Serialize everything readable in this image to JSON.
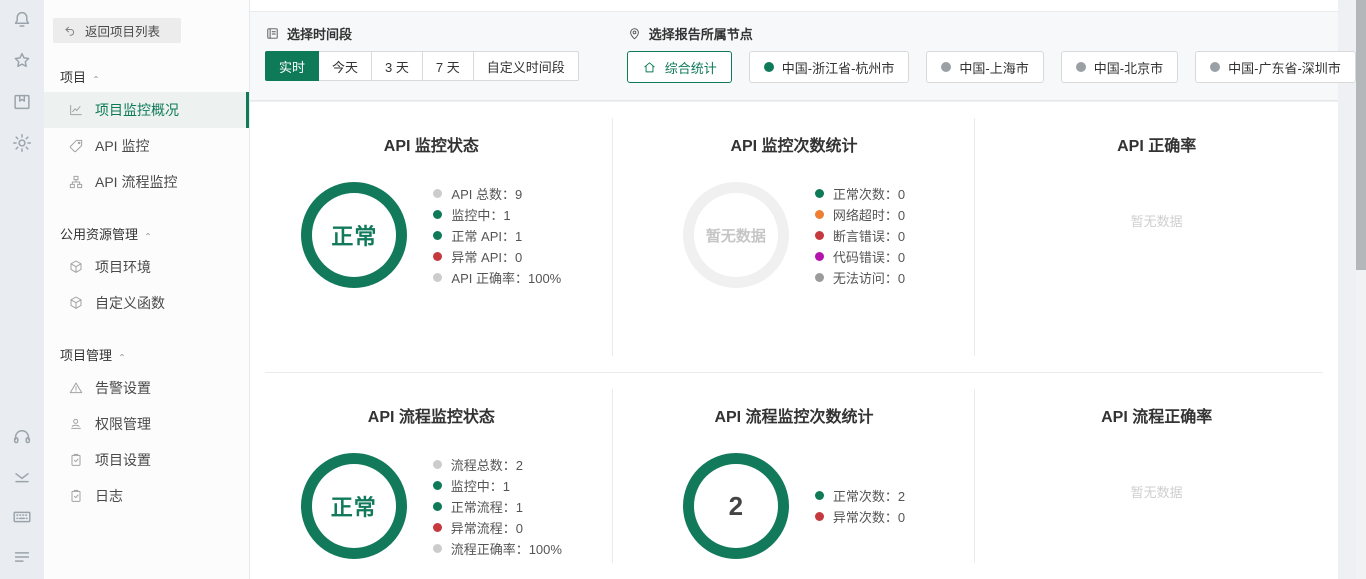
{
  "accent": "#0e7a58",
  "punctuation": {
    "colon": "："
  },
  "rail": {
    "top_icons": [
      "bell",
      "star",
      "archive",
      "gear"
    ],
    "bottom_icons": [
      "headset",
      "inbox",
      "keyboard",
      "list"
    ]
  },
  "sidebar": {
    "back_button": "返回项目列表",
    "sections": [
      {
        "label": "项目",
        "items": [
          {
            "icon": "chart-line",
            "label": "项目监控概况",
            "active": true
          },
          {
            "icon": "tag",
            "label": "API 监控",
            "active": false
          },
          {
            "icon": "sitemap",
            "label": "API 流程监控",
            "active": false
          }
        ]
      },
      {
        "label": "公用资源管理",
        "items": [
          {
            "icon": "cube",
            "label": "项目环境",
            "active": false
          },
          {
            "icon": "cube",
            "label": "自定义函数",
            "active": false
          }
        ]
      },
      {
        "label": "项目管理",
        "items": [
          {
            "icon": "warning",
            "label": "告警设置",
            "active": false
          },
          {
            "icon": "user",
            "label": "权限管理",
            "active": false
          },
          {
            "icon": "clipboard",
            "label": "项目设置",
            "active": false
          },
          {
            "icon": "clipboard",
            "label": "日志",
            "active": false
          }
        ]
      }
    ]
  },
  "filterbar": {
    "time": {
      "label": "选择时间段",
      "options": [
        {
          "label": "实时",
          "active": true
        },
        {
          "label": "今天",
          "active": false
        },
        {
          "label": "3 天",
          "active": false
        },
        {
          "label": "7 天",
          "active": false
        },
        {
          "label": "自定义时间段",
          "active": false
        }
      ]
    },
    "node": {
      "label": "选择报告所属节点",
      "summary_label": "综合统计",
      "nodes": [
        {
          "label": "中国-浙江省-杭州市",
          "dot_color": "#0e7a58"
        },
        {
          "label": "中国-上海市",
          "dot_color": "#9aa0a6"
        },
        {
          "label": "中国-北京市",
          "dot_color": "#9aa0a6"
        },
        {
          "label": "中国-广东省-深圳市",
          "dot_color": "#9aa0a6"
        }
      ]
    }
  },
  "cards": [
    {
      "title": "API 监控状态",
      "ring": {
        "text": "正常",
        "variant": "ok",
        "color": "#127a5b",
        "text_color": "#127a5b"
      },
      "legend": [
        {
          "dot": "#cccccc",
          "label": "API 总数",
          "value": "9"
        },
        {
          "dot": "#0e7a58",
          "label": "监控中",
          "value": "1"
        },
        {
          "dot": "#0e7a58",
          "label": "正常 API",
          "value": "1"
        },
        {
          "dot": "#c5393e",
          "label": "异常 API",
          "value": "0"
        },
        {
          "dot": "#cccccc",
          "label": "API 正确率",
          "value": "100%"
        }
      ]
    },
    {
      "title": "API 监控次数统计",
      "ring": {
        "text": "暂无数据",
        "variant": "empty",
        "color": "#f0f0f0",
        "text_color": "#c6c6c6"
      },
      "legend": [
        {
          "dot": "#0e7a58",
          "label": "正常次数",
          "value": "0"
        },
        {
          "dot": "#ee7e31",
          "label": "网络超时",
          "value": "0"
        },
        {
          "dot": "#c5393e",
          "label": "断言错误",
          "value": "0"
        },
        {
          "dot": "#b513ad",
          "label": "代码错误",
          "value": "0"
        },
        {
          "dot": "#9b9b9b",
          "label": "无法访问",
          "value": "0"
        }
      ]
    },
    {
      "title": "API 正确率",
      "empty_text": "暂无数据"
    },
    {
      "title": "API 流程监控状态",
      "ring": {
        "text": "正常",
        "variant": "ok",
        "color": "#127a5b",
        "text_color": "#127a5b"
      },
      "legend": [
        {
          "dot": "#cccccc",
          "label": "流程总数",
          "value": "2"
        },
        {
          "dot": "#0e7a58",
          "label": "监控中",
          "value": "1"
        },
        {
          "dot": "#0e7a58",
          "label": "正常流程",
          "value": "1"
        },
        {
          "dot": "#c5393e",
          "label": "异常流程",
          "value": "0"
        },
        {
          "dot": "#cccccc",
          "label": "流程正确率",
          "value": "100%"
        }
      ]
    },
    {
      "title": "API 流程监控次数统计",
      "ring": {
        "text": "2",
        "variant": "count",
        "color": "#127a5b",
        "text_color": "#444444"
      },
      "legend": [
        {
          "dot": "#0e7a58",
          "label": "正常次数",
          "value": "2"
        },
        {
          "dot": "#c5393e",
          "label": "异常次数",
          "value": "0"
        }
      ]
    },
    {
      "title": "API 流程正确率",
      "empty_text": "暂无数据"
    }
  ]
}
